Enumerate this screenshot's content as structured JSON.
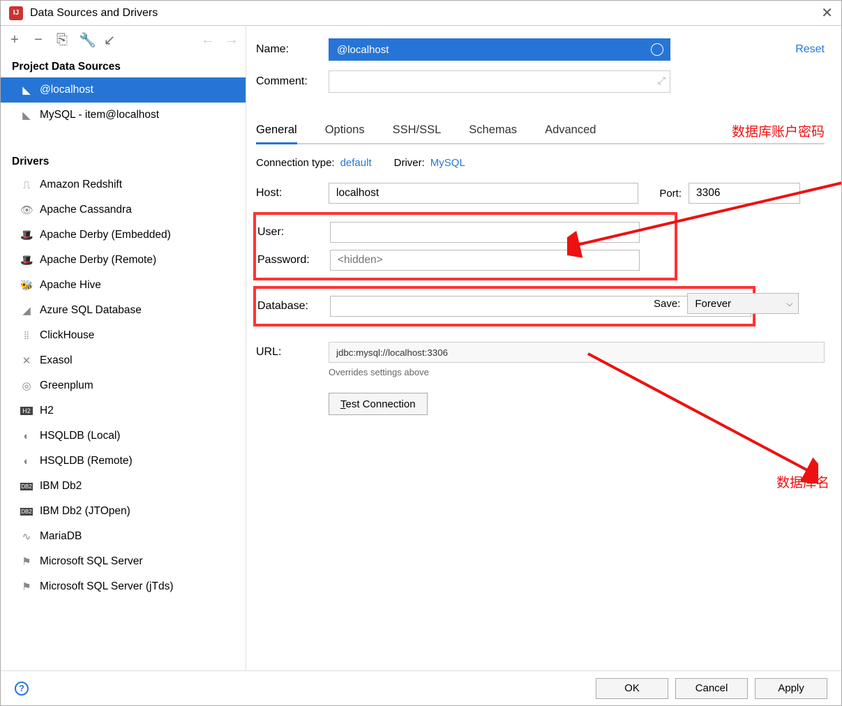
{
  "title": "Data Sources and Drivers",
  "sidebar": {
    "section1": "Project Data Sources",
    "items1": [
      {
        "label": "@localhost",
        "selected": true
      },
      {
        "label": "MySQL - item@localhost",
        "selected": false
      }
    ],
    "section2": "Drivers",
    "drivers": [
      "Amazon Redshift",
      "Apache Cassandra",
      "Apache Derby (Embedded)",
      "Apache Derby (Remote)",
      "Apache Hive",
      "Azure SQL Database",
      "ClickHouse",
      "Exasol",
      "Greenplum",
      "H2",
      "HSQLDB (Local)",
      "HSQLDB (Remote)",
      "IBM Db2",
      "IBM Db2 (JTOpen)",
      "MariaDB",
      "Microsoft SQL Server",
      "Microsoft SQL Server (jTds)"
    ]
  },
  "form": {
    "name_label": "Name:",
    "name_value": "@localhost",
    "comment_label": "Comment:",
    "reset": "Reset",
    "tabs": [
      "General",
      "Options",
      "SSH/SSL",
      "Schemas",
      "Advanced"
    ],
    "annotation1": "数据库账户密码",
    "annotation2": "数据库名",
    "conn_type_label": "Connection type:",
    "conn_type_value": "default",
    "driver_label": "Driver:",
    "driver_value": "MySQL",
    "host_label": "Host:",
    "host_value": "localhost",
    "port_label": "Port:",
    "port_value": "3306",
    "user_label": "User:",
    "user_value": "",
    "password_label": "Password:",
    "password_placeholder": "<hidden>",
    "save_label": "Save:",
    "save_value": "Forever",
    "database_label": "Database:",
    "database_value": "",
    "url_label": "URL:",
    "url_value": "jdbc:mysql://localhost:3306",
    "url_hint": "Overrides settings above",
    "test_btn": "Test Connection"
  },
  "footer": {
    "ok": "OK",
    "cancel": "Cancel",
    "apply": "Apply"
  }
}
